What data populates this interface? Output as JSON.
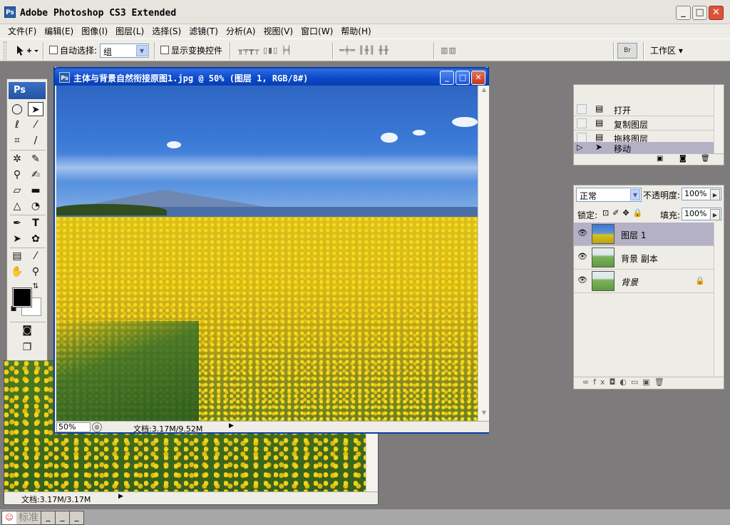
{
  "app": {
    "title": "Adobe Photoshop CS3 Extended",
    "logo": "Ps",
    "window_buttons": {
      "minimize": "_",
      "maximize": "□",
      "close": "✕"
    }
  },
  "menu": [
    "文件(F)",
    "编辑(E)",
    "图像(I)",
    "图层(L)",
    "选择(S)",
    "滤镜(T)",
    "分析(A)",
    "视图(V)",
    "窗口(W)",
    "帮助(H)"
  ],
  "options": {
    "tool_icon": "move-tool-icon",
    "auto_select_label": "自动选择:",
    "auto_select_value": "组",
    "show_transform_label": "显示变换控件",
    "workspace_label": "工作区 ▾",
    "bridge_label": "Br"
  },
  "toolbox": {
    "header": "Ps"
  },
  "document": {
    "title": "主体与背景自然衔接原图1.jpg @ 50% (图层 1, RGB/8#)",
    "zoom": "50%",
    "info": "文档:3.17M/9.52M"
  },
  "bg_document": {
    "info": "文档:3.17M/3.17M"
  },
  "history": {
    "items": [
      {
        "label": "打开",
        "selected": false
      },
      {
        "label": "复制图层",
        "selected": false
      },
      {
        "label": "拖移图层",
        "selected": false
      },
      {
        "label": "移动",
        "selected": true
      }
    ]
  },
  "layers": {
    "blend_mode": "正常",
    "opacity_label": "不透明度:",
    "opacity_value": "100%",
    "lock_label": "锁定:",
    "fill_label": "填充:",
    "fill_value": "100%",
    "items": [
      {
        "name": "图层 1",
        "selected": true,
        "locked": false
      },
      {
        "name": "背景 副本",
        "selected": false,
        "locked": false
      },
      {
        "name": "背景",
        "selected": false,
        "locked": true
      }
    ]
  },
  "taskbar": {
    "ime_label": "标准"
  }
}
